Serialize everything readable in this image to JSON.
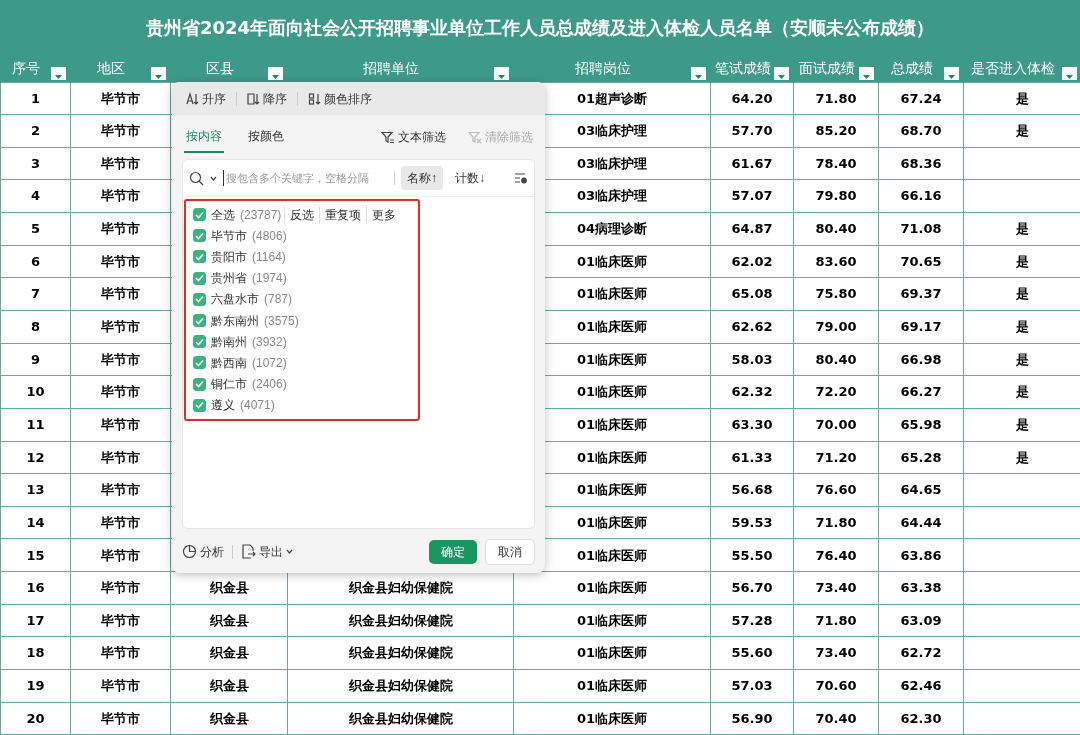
{
  "title": "贵州省2024年面向社会公开招聘事业单位工作人员总成绩及进入体检人员名单（安顺未公布成绩）",
  "columns": [
    {
      "label": "序号"
    },
    {
      "label": "地区"
    },
    {
      "label": "区县"
    },
    {
      "label": "招聘单位"
    },
    {
      "label": "招聘岗位"
    },
    {
      "label": "笔试成绩"
    },
    {
      "label": "面试成绩"
    },
    {
      "label": "总成绩"
    },
    {
      "label": "是否进入体检"
    }
  ],
  "rows": [
    {
      "no": "1",
      "region": "毕节市",
      "post": "01超声诊断",
      "written": "64.20",
      "interview": "71.80",
      "total": "67.24",
      "exam": "是"
    },
    {
      "no": "2",
      "region": "毕节市",
      "post": "03临床护理",
      "written": "57.70",
      "interview": "85.20",
      "total": "68.70",
      "exam": "是"
    },
    {
      "no": "3",
      "region": "毕节市",
      "post": "03临床护理",
      "written": "61.67",
      "interview": "78.40",
      "total": "68.36"
    },
    {
      "no": "4",
      "region": "毕节市",
      "post": "03临床护理",
      "written": "57.07",
      "interview": "79.80",
      "total": "66.16"
    },
    {
      "no": "5",
      "region": "毕节市",
      "post": "04病理诊断",
      "written": "64.87",
      "interview": "80.40",
      "total": "71.08",
      "exam": "是"
    },
    {
      "no": "6",
      "region": "毕节市",
      "post": "01临床医师",
      "written": "62.02",
      "interview": "83.60",
      "total": "70.65",
      "exam": "是"
    },
    {
      "no": "7",
      "region": "毕节市",
      "post": "01临床医师",
      "written": "65.08",
      "interview": "75.80",
      "total": "69.37",
      "exam": "是"
    },
    {
      "no": "8",
      "region": "毕节市",
      "post": "01临床医师",
      "written": "62.62",
      "interview": "79.00",
      "total": "69.17",
      "exam": "是"
    },
    {
      "no": "9",
      "region": "毕节市",
      "post": "01临床医师",
      "written": "58.03",
      "interview": "80.40",
      "total": "66.98",
      "exam": "是"
    },
    {
      "no": "10",
      "region": "毕节市",
      "post": "01临床医师",
      "written": "62.32",
      "interview": "72.20",
      "total": "66.27",
      "exam": "是"
    },
    {
      "no": "11",
      "region": "毕节市",
      "post": "01临床医师",
      "written": "63.30",
      "interview": "70.00",
      "total": "65.98",
      "exam": "是"
    },
    {
      "no": "12",
      "region": "毕节市",
      "post": "01临床医师",
      "written": "61.33",
      "interview": "71.20",
      "total": "65.28",
      "exam": "是"
    },
    {
      "no": "13",
      "region": "毕节市",
      "post": "01临床医师",
      "written": "56.68",
      "interview": "76.60",
      "total": "64.65"
    },
    {
      "no": "14",
      "region": "毕节市",
      "post": "01临床医师",
      "written": "59.53",
      "interview": "71.80",
      "total": "64.44"
    },
    {
      "no": "15",
      "region": "毕节市",
      "post": "01临床医师",
      "written": "55.50",
      "interview": "76.40",
      "total": "63.86"
    },
    {
      "no": "16",
      "region": "毕节市",
      "county": "织金县",
      "unit": "织金县妇幼保健院",
      "post": "01临床医师",
      "written": "56.70",
      "interview": "73.40",
      "total": "63.38"
    },
    {
      "no": "17",
      "region": "毕节市",
      "county": "织金县",
      "unit": "织金县妇幼保健院",
      "post": "01临床医师",
      "written": "57.28",
      "interview": "71.80",
      "total": "63.09"
    },
    {
      "no": "18",
      "region": "毕节市",
      "county": "织金县",
      "unit": "织金县妇幼保健院",
      "post": "01临床医师",
      "written": "55.60",
      "interview": "73.40",
      "total": "62.72"
    },
    {
      "no": "19",
      "region": "毕节市",
      "county": "织金县",
      "unit": "织金县妇幼保健院",
      "post": "01临床医师",
      "written": "57.03",
      "interview": "70.60",
      "total": "62.46"
    },
    {
      "no": "20",
      "region": "毕节市",
      "county": "织金县",
      "unit": "织金县妇幼保健院",
      "post": "01临床医师",
      "written": "56.90",
      "interview": "70.40",
      "total": "62.30"
    }
  ],
  "filter_popup": {
    "sort_buttons": [
      {
        "kind": "asc",
        "label": "升序"
      },
      {
        "kind": "desc",
        "label": "降序"
      },
      {
        "kind": "color",
        "label": "颜色排序"
      }
    ],
    "tabs": [
      {
        "label": "按内容",
        "selected": true
      },
      {
        "label": "按颜色",
        "selected": false
      }
    ],
    "text_filter": "文本筛选",
    "clear_filter": {
      "label": "清除筛选",
      "disabled": true
    },
    "search": {
      "placeholder": "搜包含多个关键字，空格分隔"
    },
    "order_buttons": [
      {
        "label": "名称↑",
        "selected": true
      },
      {
        "label": "计数↓",
        "selected": false
      }
    ],
    "select_all": {
      "label": "全选",
      "count": "(23787)",
      "checked": true
    },
    "select_actions": [
      "反选",
      "重复项",
      "更多"
    ],
    "items": [
      {
        "label": "毕节市",
        "count": "(4806)",
        "checked": true
      },
      {
        "label": "贵阳市",
        "count": "(1164)",
        "checked": true
      },
      {
        "label": "贵州省",
        "count": "(1974)",
        "checked": true
      },
      {
        "label": "六盘水市",
        "count": "(787)",
        "checked": true
      },
      {
        "label": "黔东南州",
        "count": "(3575)",
        "checked": true
      },
      {
        "label": "黔南州",
        "count": "(3932)",
        "checked": true
      },
      {
        "label": "黔西南",
        "count": "(1072)",
        "checked": true
      },
      {
        "label": "铜仁市",
        "count": "(2406)",
        "checked": true
      },
      {
        "label": "遵义",
        "count": "(4071)",
        "checked": true
      }
    ],
    "analyze": "分析",
    "export": "导出",
    "ok": "确定",
    "cancel": "取消"
  }
}
